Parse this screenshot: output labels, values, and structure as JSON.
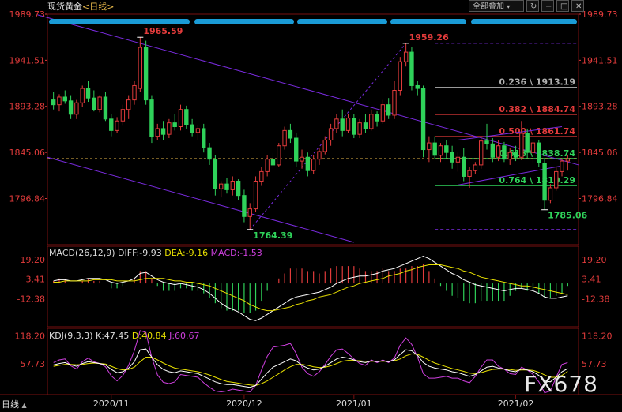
{
  "header": {
    "instrument": "现货黄金",
    "period": "<日线>",
    "period_selector": "全部叠加",
    "icons": [
      "refresh-icon",
      "minus-icon",
      "maximize-icon",
      "close-icon"
    ]
  },
  "colors": {
    "up": "#e23b3b",
    "down": "#2fd25a",
    "channel": "#7a2be0",
    "fib_line": "#b0b0b0",
    "dif": "#ffffff",
    "dea": "#e8e000",
    "k": "#ffffff",
    "d": "#e8e000",
    "j": "#d040e0",
    "price_axis": "#e23b3b"
  },
  "chart_data": [
    {
      "type": "candlestick",
      "name": "price",
      "yticks": [
        1989.73,
        1941.51,
        1893.28,
        1845.06,
        1796.84
      ],
      "ylim": [
        1748.5,
        1989.73
      ],
      "xticks": [
        "2020/11",
        "2020/12",
        "2021/01",
        "2021/02"
      ],
      "annotations": {
        "high_1": "1965.59",
        "high_2": "1959.26",
        "low_1": "1764.39",
        "low_2": "1785.06"
      },
      "fib_levels": [
        {
          "label": "0.236 \\ 1913.19",
          "value": 1913.19
        },
        {
          "label": "0.382 \\ 1884.74",
          "value": 1884.74
        },
        {
          "label": "0.500 \\ 1861.74",
          "value": 1861.74
        },
        {
          "label": "0.618 \\ 1838.74",
          "value": 1838.74
        },
        {
          "label": "0.764 \\ 1810.29",
          "value": 1810.29
        }
      ],
      "dashed_levels": [
        1959.26,
        1764.39
      ],
      "last_price_line": 1838.5,
      "candles": [
        {
          "o": 1900,
          "h": 1908,
          "l": 1890,
          "c": 1895
        },
        {
          "o": 1895,
          "h": 1906,
          "l": 1888,
          "c": 1903
        },
        {
          "o": 1903,
          "h": 1910,
          "l": 1896,
          "c": 1899
        },
        {
          "o": 1899,
          "h": 1905,
          "l": 1880,
          "c": 1885
        },
        {
          "o": 1885,
          "h": 1900,
          "l": 1880,
          "c": 1897
        },
        {
          "o": 1897,
          "h": 1915,
          "l": 1893,
          "c": 1912
        },
        {
          "o": 1912,
          "h": 1920,
          "l": 1898,
          "c": 1902
        },
        {
          "o": 1902,
          "h": 1910,
          "l": 1888,
          "c": 1890
        },
        {
          "o": 1890,
          "h": 1905,
          "l": 1887,
          "c": 1903
        },
        {
          "o": 1903,
          "h": 1908,
          "l": 1878,
          "c": 1880
        },
        {
          "o": 1880,
          "h": 1885,
          "l": 1862,
          "c": 1868
        },
        {
          "o": 1868,
          "h": 1882,
          "l": 1865,
          "c": 1878
        },
        {
          "o": 1878,
          "h": 1895,
          "l": 1873,
          "c": 1890
        },
        {
          "o": 1890,
          "h": 1905,
          "l": 1880,
          "c": 1900
        },
        {
          "o": 1900,
          "h": 1920,
          "l": 1895,
          "c": 1915
        },
        {
          "o": 1912,
          "h": 1965.59,
          "l": 1908,
          "c": 1955
        },
        {
          "o": 1955,
          "h": 1962,
          "l": 1895,
          "c": 1900
        },
        {
          "o": 1900,
          "h": 1905,
          "l": 1855,
          "c": 1862
        },
        {
          "o": 1862,
          "h": 1875,
          "l": 1858,
          "c": 1870
        },
        {
          "o": 1870,
          "h": 1878,
          "l": 1858,
          "c": 1864
        },
        {
          "o": 1864,
          "h": 1880,
          "l": 1860,
          "c": 1876
        },
        {
          "o": 1876,
          "h": 1885,
          "l": 1868,
          "c": 1872
        },
        {
          "o": 1872,
          "h": 1895,
          "l": 1868,
          "c": 1890
        },
        {
          "o": 1890,
          "h": 1894,
          "l": 1870,
          "c": 1874
        },
        {
          "o": 1874,
          "h": 1880,
          "l": 1862,
          "c": 1866
        },
        {
          "o": 1866,
          "h": 1874,
          "l": 1858,
          "c": 1870
        },
        {
          "o": 1870,
          "h": 1875,
          "l": 1845,
          "c": 1850
        },
        {
          "o": 1850,
          "h": 1855,
          "l": 1832,
          "c": 1838
        },
        {
          "o": 1838,
          "h": 1842,
          "l": 1800,
          "c": 1807
        },
        {
          "o": 1807,
          "h": 1815,
          "l": 1798,
          "c": 1812
        },
        {
          "o": 1812,
          "h": 1818,
          "l": 1802,
          "c": 1806
        },
        {
          "o": 1806,
          "h": 1820,
          "l": 1800,
          "c": 1815
        },
        {
          "o": 1815,
          "h": 1817,
          "l": 1795,
          "c": 1800
        },
        {
          "o": 1800,
          "h": 1806,
          "l": 1772,
          "c": 1778
        },
        {
          "o": 1778,
          "h": 1792,
          "l": 1764.39,
          "c": 1786
        },
        {
          "o": 1786,
          "h": 1820,
          "l": 1783,
          "c": 1815
        },
        {
          "o": 1815,
          "h": 1830,
          "l": 1810,
          "c": 1825
        },
        {
          "o": 1825,
          "h": 1842,
          "l": 1820,
          "c": 1838
        },
        {
          "o": 1838,
          "h": 1845,
          "l": 1828,
          "c": 1832
        },
        {
          "o": 1832,
          "h": 1855,
          "l": 1830,
          "c": 1852
        },
        {
          "o": 1852,
          "h": 1872,
          "l": 1848,
          "c": 1868
        },
        {
          "o": 1868,
          "h": 1875,
          "l": 1855,
          "c": 1860
        },
        {
          "o": 1860,
          "h": 1865,
          "l": 1830,
          "c": 1836
        },
        {
          "o": 1836,
          "h": 1848,
          "l": 1828,
          "c": 1840
        },
        {
          "o": 1840,
          "h": 1845,
          "l": 1820,
          "c": 1826
        },
        {
          "o": 1826,
          "h": 1842,
          "l": 1822,
          "c": 1838
        },
        {
          "o": 1838,
          "h": 1850,
          "l": 1832,
          "c": 1846
        },
        {
          "o": 1846,
          "h": 1862,
          "l": 1843,
          "c": 1858
        },
        {
          "o": 1858,
          "h": 1875,
          "l": 1852,
          "c": 1870
        },
        {
          "o": 1870,
          "h": 1885,
          "l": 1865,
          "c": 1880
        },
        {
          "o": 1880,
          "h": 1890,
          "l": 1862,
          "c": 1868
        },
        {
          "o": 1868,
          "h": 1885,
          "l": 1865,
          "c": 1881
        },
        {
          "o": 1881,
          "h": 1885,
          "l": 1860,
          "c": 1864
        },
        {
          "o": 1864,
          "h": 1880,
          "l": 1860,
          "c": 1876
        },
        {
          "o": 1876,
          "h": 1885,
          "l": 1865,
          "c": 1870
        },
        {
          "o": 1870,
          "h": 1890,
          "l": 1868,
          "c": 1885
        },
        {
          "o": 1885,
          "h": 1888,
          "l": 1872,
          "c": 1878
        },
        {
          "o": 1878,
          "h": 1900,
          "l": 1875,
          "c": 1895
        },
        {
          "o": 1895,
          "h": 1902,
          "l": 1880,
          "c": 1884
        },
        {
          "o": 1884,
          "h": 1920,
          "l": 1880,
          "c": 1910
        },
        {
          "o": 1910,
          "h": 1945,
          "l": 1905,
          "c": 1940
        },
        {
          "o": 1940,
          "h": 1959.26,
          "l": 1935,
          "c": 1950
        },
        {
          "o": 1950,
          "h": 1955,
          "l": 1910,
          "c": 1915
        },
        {
          "o": 1915,
          "h": 1920,
          "l": 1905,
          "c": 1912
        },
        {
          "o": 1912,
          "h": 1915,
          "l": 1840,
          "c": 1848
        },
        {
          "o": 1848,
          "h": 1862,
          "l": 1835,
          "c": 1855
        },
        {
          "o": 1855,
          "h": 1862,
          "l": 1838,
          "c": 1842
        },
        {
          "o": 1842,
          "h": 1855,
          "l": 1835,
          "c": 1852
        },
        {
          "o": 1852,
          "h": 1858,
          "l": 1838,
          "c": 1845
        },
        {
          "o": 1845,
          "h": 1852,
          "l": 1828,
          "c": 1835
        },
        {
          "o": 1835,
          "h": 1845,
          "l": 1825,
          "c": 1840
        },
        {
          "o": 1840,
          "h": 1850,
          "l": 1815,
          "c": 1820
        },
        {
          "o": 1820,
          "h": 1830,
          "l": 1808,
          "c": 1826
        },
        {
          "o": 1826,
          "h": 1835,
          "l": 1822,
          "c": 1832
        },
        {
          "o": 1832,
          "h": 1862,
          "l": 1828,
          "c": 1857
        },
        {
          "o": 1857,
          "h": 1875,
          "l": 1848,
          "c": 1854
        },
        {
          "o": 1854,
          "h": 1860,
          "l": 1835,
          "c": 1840
        },
        {
          "o": 1840,
          "h": 1858,
          "l": 1836,
          "c": 1852
        },
        {
          "o": 1852,
          "h": 1856,
          "l": 1835,
          "c": 1838
        },
        {
          "o": 1838,
          "h": 1850,
          "l": 1832,
          "c": 1845
        },
        {
          "o": 1845,
          "h": 1852,
          "l": 1836,
          "c": 1840
        },
        {
          "o": 1840,
          "h": 1878,
          "l": 1837,
          "c": 1865
        },
        {
          "o": 1865,
          "h": 1870,
          "l": 1838,
          "c": 1845
        },
        {
          "o": 1845,
          "h": 1858,
          "l": 1833,
          "c": 1855
        },
        {
          "o": 1855,
          "h": 1858,
          "l": 1830,
          "c": 1834
        },
        {
          "o": 1834,
          "h": 1838,
          "l": 1785.06,
          "c": 1795
        },
        {
          "o": 1795,
          "h": 1812,
          "l": 1792,
          "c": 1808
        },
        {
          "o": 1808,
          "h": 1830,
          "l": 1805,
          "c": 1825
        },
        {
          "o": 1825,
          "h": 1838,
          "l": 1820,
          "c": 1836
        },
        {
          "o": 1836,
          "h": 1842,
          "l": 1826,
          "c": 1838
        }
      ]
    },
    {
      "type": "macd",
      "name": "MACD(26,12,9)",
      "labels": {
        "title": "MACD(26,12,9)",
        "dif": "DIFF:-9.93",
        "dea": "DEA:-9.16",
        "macd": "MACD:-1.53"
      },
      "yticks": [
        19.2,
        3.41,
        -12.38
      ],
      "ylim": [
        -35,
        30
      ],
      "dif": [
        2,
        3,
        3,
        2,
        2,
        3,
        4,
        4,
        4,
        3,
        1,
        0,
        1,
        2,
        4,
        8,
        9,
        6,
        3,
        1,
        0,
        -1,
        0,
        -1,
        -2,
        -3,
        -5,
        -8,
        -12,
        -16,
        -19,
        -21,
        -23,
        -26,
        -29,
        -30,
        -28,
        -25,
        -22,
        -19,
        -16,
        -13,
        -11,
        -10,
        -9,
        -8,
        -7,
        -5,
        -3,
        0,
        2,
        4,
        5,
        6,
        6,
        7,
        8,
        10,
        11,
        12,
        14,
        16,
        18,
        20,
        22,
        20,
        17,
        14,
        11,
        8,
        6,
        3,
        1,
        -1,
        -2,
        -3,
        -4,
        -5,
        -6,
        -5,
        -4,
        -4,
        -5,
        -6,
        -8,
        -11,
        -12,
        -12,
        -11,
        -10
      ],
      "dea": [
        1,
        1,
        2,
        2,
        2,
        2,
        2,
        3,
        3,
        3,
        3,
        2,
        2,
        2,
        2,
        3,
        4,
        4,
        4,
        4,
        3,
        2,
        2,
        1,
        1,
        0,
        -1,
        -2,
        -4,
        -6,
        -8,
        -10,
        -12,
        -14,
        -17,
        -19,
        -21,
        -22,
        -22,
        -21,
        -20,
        -19,
        -17,
        -16,
        -14,
        -13,
        -11,
        -10,
        -9,
        -7,
        -5,
        -3,
        -2,
        0,
        1,
        2,
        3,
        4,
        6,
        7,
        8,
        10,
        11,
        13,
        14,
        15,
        15,
        15,
        14,
        13,
        12,
        10,
        9,
        7,
        5,
        4,
        3,
        2,
        1,
        0,
        -1,
        -2,
        -2,
        -3,
        -4,
        -5,
        -6,
        -7,
        -8,
        -9
      ],
      "macd": [
        2,
        4,
        3,
        0,
        0,
        2,
        4,
        2,
        2,
        0,
        -4,
        -4,
        -2,
        0,
        4,
        10,
        10,
        4,
        -2,
        -6,
        -6,
        -6,
        -4,
        -4,
        -6,
        -6,
        -8,
        -12,
        -16,
        -20,
        -22,
        -22,
        -22,
        -24,
        -24,
        -22,
        -14,
        -6,
        0,
        4,
        8,
        12,
        12,
        12,
        10,
        10,
        8,
        10,
        12,
        14,
        14,
        14,
        14,
        12,
        10,
        10,
        10,
        12,
        10,
        10,
        12,
        12,
        14,
        14,
        16,
        10,
        4,
        -2,
        -6,
        -10,
        -12,
        -14,
        -16,
        -16,
        -14,
        -14,
        -14,
        -14,
        -14,
        -10,
        -6,
        -4,
        -6,
        -6,
        -8,
        -12,
        -12,
        -10,
        -8,
        -2
      ]
    },
    {
      "type": "kdj",
      "name": "KDJ(9,3,3)",
      "labels": {
        "title": "KDJ(9,3,3)",
        "k": "K:47.45",
        "d": "D:40.84",
        "j": "J:60.67"
      },
      "yticks": [
        118.2,
        57.73
      ],
      "ylim": [
        -10,
        135
      ],
      "k": [
        55,
        58,
        60,
        55,
        52,
        58,
        62,
        60,
        58,
        55,
        45,
        38,
        40,
        48,
        62,
        88,
        90,
        72,
        55,
        45,
        40,
        38,
        42,
        40,
        38,
        36,
        30,
        24,
        18,
        14,
        12,
        12,
        10,
        8,
        6,
        10,
        24,
        38,
        50,
        56,
        62,
        68,
        64,
        54,
        48,
        44,
        46,
        52,
        60,
        68,
        72,
        70,
        66,
        62,
        60,
        64,
        62,
        64,
        62,
        66,
        78,
        88,
        86,
        76,
        60,
        52,
        48,
        46,
        44,
        40,
        38,
        34,
        30,
        34,
        42,
        50,
        52,
        48,
        46,
        42,
        40,
        46,
        44,
        40,
        32,
        20,
        18,
        28,
        40,
        47
      ],
      "d": [
        52,
        54,
        56,
        56,
        55,
        56,
        58,
        59,
        58,
        57,
        52,
        47,
        44,
        45,
        50,
        62,
        72,
        72,
        66,
        59,
        53,
        48,
        46,
        44,
        42,
        40,
        37,
        33,
        28,
        23,
        19,
        17,
        15,
        13,
        11,
        10,
        14,
        20,
        28,
        36,
        44,
        51,
        56,
        56,
        54,
        51,
        49,
        50,
        53,
        58,
        63,
        65,
        65,
        64,
        63,
        63,
        63,
        63,
        63,
        64,
        68,
        75,
        79,
        78,
        72,
        65,
        59,
        55,
        51,
        47,
        44,
        41,
        37,
        36,
        38,
        42,
        45,
        46,
        46,
        45,
        43,
        44,
        44,
        43,
        39,
        33,
        28,
        28,
        32,
        41
      ],
      "j": [
        60,
        66,
        68,
        53,
        46,
        62,
        70,
        62,
        58,
        51,
        31,
        20,
        32,
        54,
        86,
        130,
        126,
        72,
        33,
        17,
        14,
        18,
        34,
        32,
        30,
        28,
        16,
        6,
        -2,
        -4,
        -2,
        2,
        0,
        -2,
        -4,
        10,
        44,
        74,
        94,
        96,
        98,
        102,
        80,
        50,
        36,
        30,
        40,
        56,
        74,
        88,
        90,
        80,
        68,
        58,
        54,
        66,
        60,
        66,
        60,
        70,
        98,
        114,
        100,
        72,
        36,
        26,
        26,
        28,
        30,
        26,
        26,
        20,
        16,
        30,
        50,
        66,
        66,
        52,
        46,
        36,
        34,
        50,
        44,
        34,
        18,
        -6,
        -2,
        28,
        56,
        60
      ]
    }
  ],
  "watermark": "FX678",
  "bottom_tab": "日线"
}
